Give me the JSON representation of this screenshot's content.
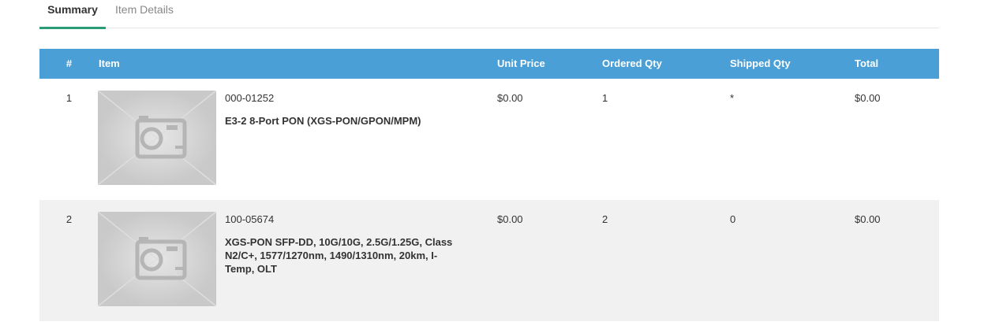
{
  "tabs": [
    {
      "label": "Summary",
      "active": true
    },
    {
      "label": "Item Details",
      "active": false
    }
  ],
  "table": {
    "headers": {
      "num": "#",
      "item": "Item",
      "unit_price": "Unit Price",
      "ordered_qty": "Ordered Qty",
      "shipped_qty": "Shipped Qty",
      "total": "Total"
    },
    "header_color": "#4a9fd6",
    "rows": [
      {
        "num": "1",
        "image": "placeholder-camera-image",
        "sku": "000-01252",
        "description": "E3-2 8-Port PON (XGS-PON/GPON/MPM)",
        "unit_price": "$0.00",
        "ordered_qty": "1",
        "shipped_qty": "*",
        "total": "$0.00"
      },
      {
        "num": "2",
        "image": "placeholder-camera-image",
        "sku": "100-05674",
        "description": "XGS-PON SFP-DD, 10G/10G, 2.5G/1.25G, Class N2/C+, 1577/1270nm, 1490/1310nm, 20km, I-Temp, OLT",
        "unit_price": "$0.00",
        "ordered_qty": "2",
        "shipped_qty": "0",
        "total": "$0.00"
      }
    ]
  },
  "colors": {
    "active_tab_underline": "#2a9d75",
    "alt_row_bg": "#f1f1f1"
  }
}
